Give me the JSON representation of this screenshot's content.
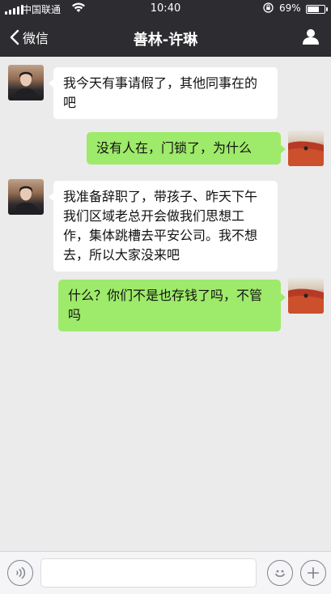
{
  "status_bar": {
    "carrier": "中国联通",
    "time": "10:40",
    "battery": "69%",
    "battery_level": 0.69
  },
  "nav": {
    "back_label": "微信",
    "title": "善林-许琳",
    "profile_icon": "person-icon"
  },
  "messages": [
    {
      "side": "left",
      "text": "我今天有事请假了，其他同事在的吧"
    },
    {
      "side": "right",
      "text": "没有人在，门锁了，为什么"
    },
    {
      "side": "left",
      "text": "我准备辞职了，带孩子、昨天下午我们区域老总开会做我们思想工作，集体跳槽去平安公司。我不想去，所以大家没来吧"
    },
    {
      "side": "right",
      "text": "什么？你们不是也存钱了吗，不管吗"
    }
  ],
  "input_bar": {
    "voice_icon": "voice-icon",
    "emoji_icon": "emoji-icon",
    "plus_icon": "plus-icon",
    "text_value": ""
  }
}
